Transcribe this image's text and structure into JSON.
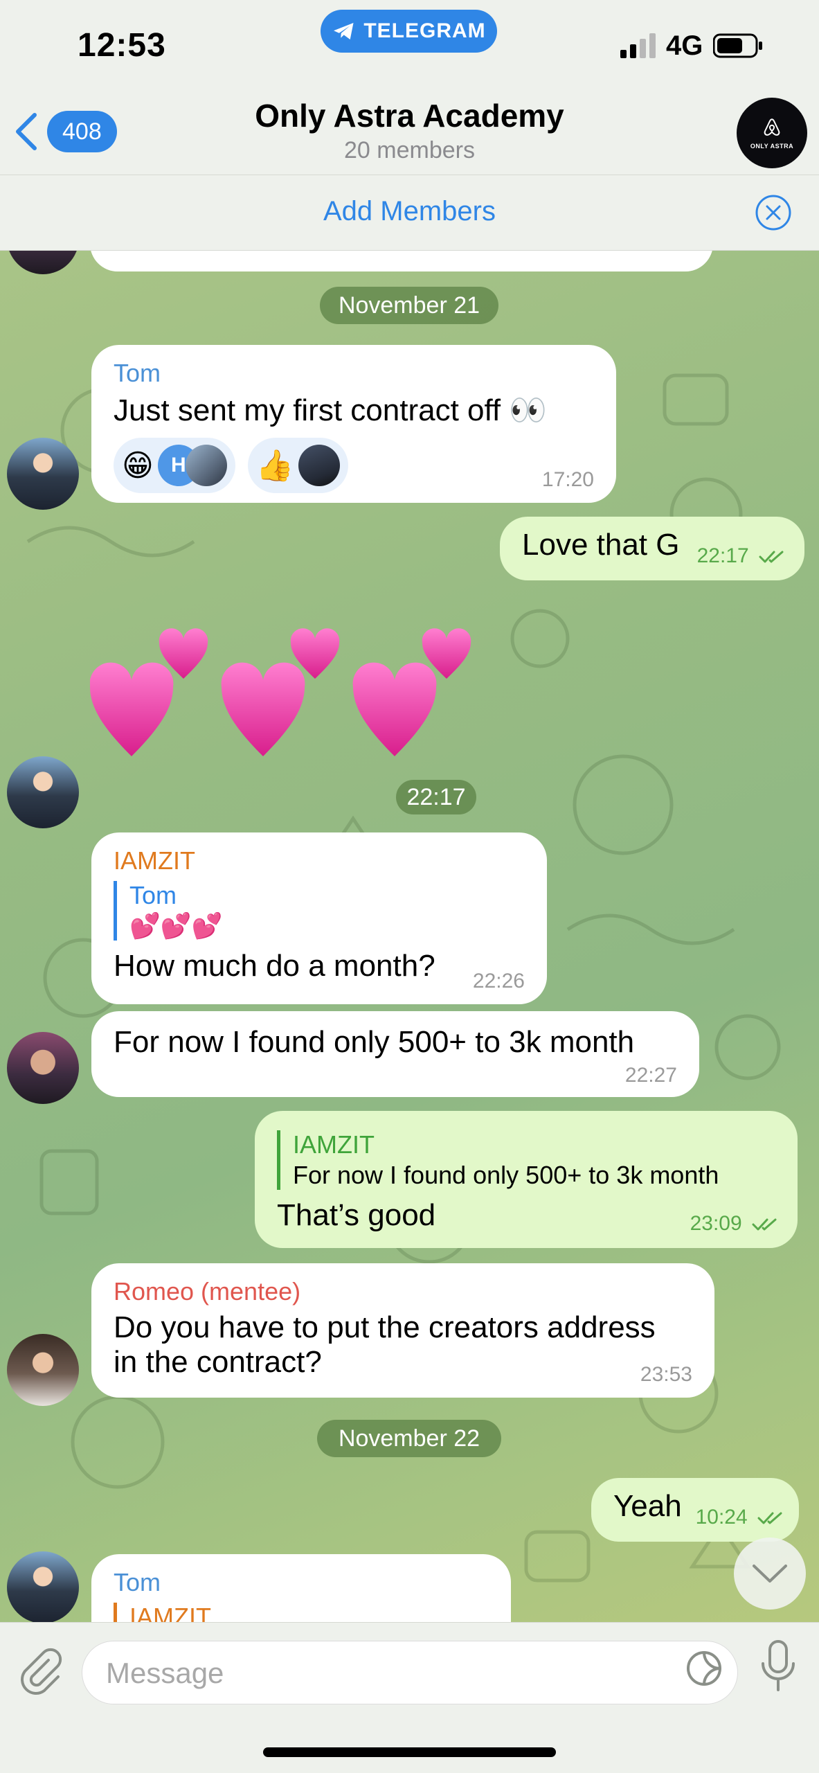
{
  "status_bar": {
    "time": "12:53",
    "app_pill": "TELEGRAM",
    "network": "4G"
  },
  "header": {
    "back_count": "408",
    "title": "Only Astra Academy",
    "subtitle": "20 members",
    "avatar_text": "ONLY ASTRA"
  },
  "add_members": {
    "label": "Add Members"
  },
  "dates": {
    "nov21": "November 21",
    "stamp": "22:17",
    "nov22": "November 22"
  },
  "messages": {
    "m1": {
      "sender": "Tom",
      "text": "Just sent my first contract off 👀",
      "time": "17:20",
      "reactions": [
        {
          "emoji": "😁",
          "badge": "H"
        },
        {
          "emoji": "👍"
        }
      ]
    },
    "m2": {
      "text": "Love that G",
      "time": "22:17"
    },
    "m3": {
      "sender": "IAMZIT",
      "quote_name": "Tom",
      "quote_text": "💕💕💕",
      "text": "How much do a month?",
      "time": "22:26"
    },
    "m4": {
      "text": "For now I found only 500+ to 3k month",
      "time": "22:27"
    },
    "m5": {
      "quote_name": "IAMZIT",
      "quote_text": "For now I found only 500+ to 3k month",
      "text": "That’s good",
      "time": "23:09"
    },
    "m6": {
      "sender": "Romeo (mentee)",
      "text_line1": "Do you have to put the creators address",
      "text_line2": "in the contract?",
      "time": "23:53"
    },
    "m7": {
      "text": "Yeah",
      "time": "10:24"
    },
    "m8": {
      "sender": "Tom",
      "quote_name": "IAMZIT"
    }
  },
  "input": {
    "placeholder": "Message"
  },
  "colors": {
    "accent": "#2f86e6",
    "outgoing": "#e2f8c9",
    "sender_tom": "#4a90d6",
    "sender_iamzit": "#e07a1e",
    "sender_romeo": "#e0564e"
  }
}
